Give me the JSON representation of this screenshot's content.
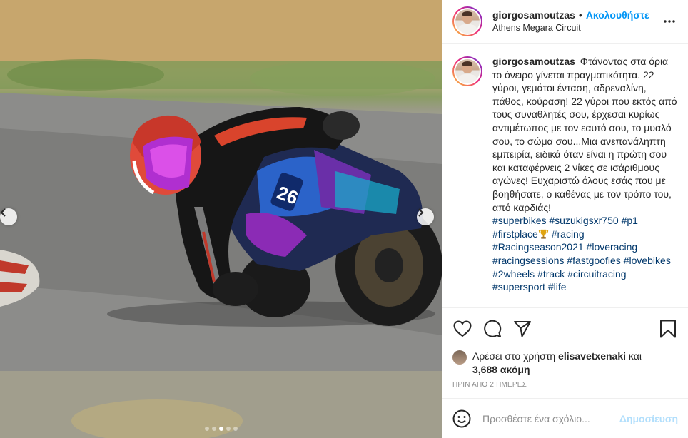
{
  "post": {
    "username": "giorgosamoutzas",
    "follow_label": "Ακολουθήστε",
    "separator": "•",
    "location": "Athens Megara Circuit"
  },
  "caption": {
    "username": "giorgosamoutzas",
    "text": "Φτάνοντας στα όρια το όνειρο γίνεται πραγματικότητα. 22 γύροι, γεμάτοι ένταση, αδρεναλίνη, πάθος, κούραση! 22 γύροι που εκτός από τους συναθλητές σου, έρχεσαι κυρίως αντιμέτωπος με τον εαυτό σου, το μυαλό σου, το σώμα σου...Μια ανεπανάληπτη εμπειρία, ειδικά όταν είναι η πρώτη σου και καταφέρνεις 2 νίκες σε ισάριθμους αγώνες! Ευχαριστώ όλους εσάς που με βοηθήσατε, ο καθένας με τον τρόπο του, από καρδιάς!",
    "hashtags": [
      "#superbikes",
      "#suzukigsxr750",
      "#p1",
      "#firstplace",
      "#racing",
      "#Racingseason2021",
      "#loveracing",
      "#racingsessions",
      "#fastgoofies",
      "#lovebikes",
      "#2wheels",
      "#track",
      "#circuitracing",
      "#supersport",
      "#life"
    ]
  },
  "likes": {
    "prefix": "Αρέσει στο χρήστη",
    "user": "elisavetxenaki",
    "conj": "και",
    "count": "3,688 ακόμη"
  },
  "time_ago": "ΠΡΙΝ ΑΠΟ 2 ΗΜΕΡΕΣ",
  "comment": {
    "placeholder": "Προσθέστε ένα σχόλιο...",
    "post_label": "Δημοσίευση"
  },
  "carousel": {
    "total": 5,
    "active_index": 2
  },
  "photo": {
    "bike_number": "26"
  },
  "icons": [
    "chevron-left-icon",
    "chevron-right-icon",
    "more-icon",
    "heart-icon",
    "comment-icon",
    "share-icon",
    "bookmark-icon",
    "emoji-icon",
    "trophy-icon"
  ],
  "colors": {
    "accent": "#0095f6",
    "link": "#00376b",
    "muted": "#8e8e8e",
    "post_disabled": "#b2dffc"
  }
}
